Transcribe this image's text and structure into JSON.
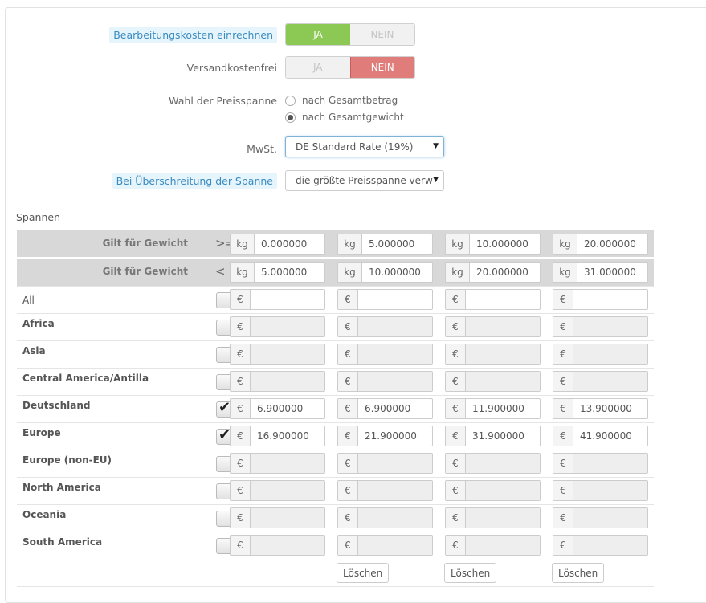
{
  "form": {
    "handling_label": "Bearbeitungskosten einrechnen",
    "handling_yes": "JA",
    "handling_no": "NEIN",
    "free_label": "Versandkostenfrei",
    "free_yes": "JA",
    "free_no": "NEIN",
    "range_label": "Wahl der Preisspanne",
    "range_opt1": "nach Gesamtbetrag",
    "range_opt2": "nach Gesamtgewicht",
    "tax_label": "MwSt.",
    "tax_value": "DE Standard Rate (19%)",
    "exceed_label": "Bei Überschreitung der Spanne",
    "exceed_value": "die größte Preisspanne verw"
  },
  "ranges": {
    "title": "Spannen",
    "from_label": "Gilt für Gewicht",
    "from_op": ">=",
    "to_label": "Gilt für Gewicht",
    "to_op": "<",
    "unit": "kg",
    "currency": "€",
    "from": [
      "0.000000",
      "5.000000",
      "10.000000",
      "20.000000"
    ],
    "to": [
      "5.000000",
      "10.000000",
      "20.000000",
      "31.000000"
    ],
    "delete_label": "Löschen"
  },
  "zones": [
    {
      "name": "All",
      "checked": false,
      "values": [
        "",
        "",
        "",
        ""
      ]
    },
    {
      "name": "Africa",
      "checked": false,
      "values": [
        "",
        "",
        "",
        ""
      ]
    },
    {
      "name": "Asia",
      "checked": false,
      "values": [
        "",
        "",
        "",
        ""
      ]
    },
    {
      "name": "Central America/Antilla",
      "checked": false,
      "values": [
        "",
        "",
        "",
        ""
      ]
    },
    {
      "name": "Deutschland",
      "checked": true,
      "values": [
        "6.900000",
        "6.900000",
        "11.900000",
        "13.900000"
      ]
    },
    {
      "name": "Europe",
      "checked": true,
      "values": [
        "16.900000",
        "21.900000",
        "31.900000",
        "41.900000"
      ]
    },
    {
      "name": "Europe (non-EU)",
      "checked": false,
      "values": [
        "",
        "",
        "",
        ""
      ]
    },
    {
      "name": "North America",
      "checked": false,
      "values": [
        "",
        "",
        "",
        ""
      ]
    },
    {
      "name": "Oceania",
      "checked": false,
      "values": [
        "",
        "",
        "",
        ""
      ]
    },
    {
      "name": "South America",
      "checked": false,
      "values": [
        "",
        "",
        "",
        ""
      ]
    }
  ],
  "icons": {
    "check": "check-icon",
    "caret": "caret-down-icon"
  },
  "colors": {
    "yes_active": "#8bc954",
    "no_active": "#e07c79",
    "label_highlight": "#3a8bc0",
    "header_row": "#d8d8d8"
  }
}
